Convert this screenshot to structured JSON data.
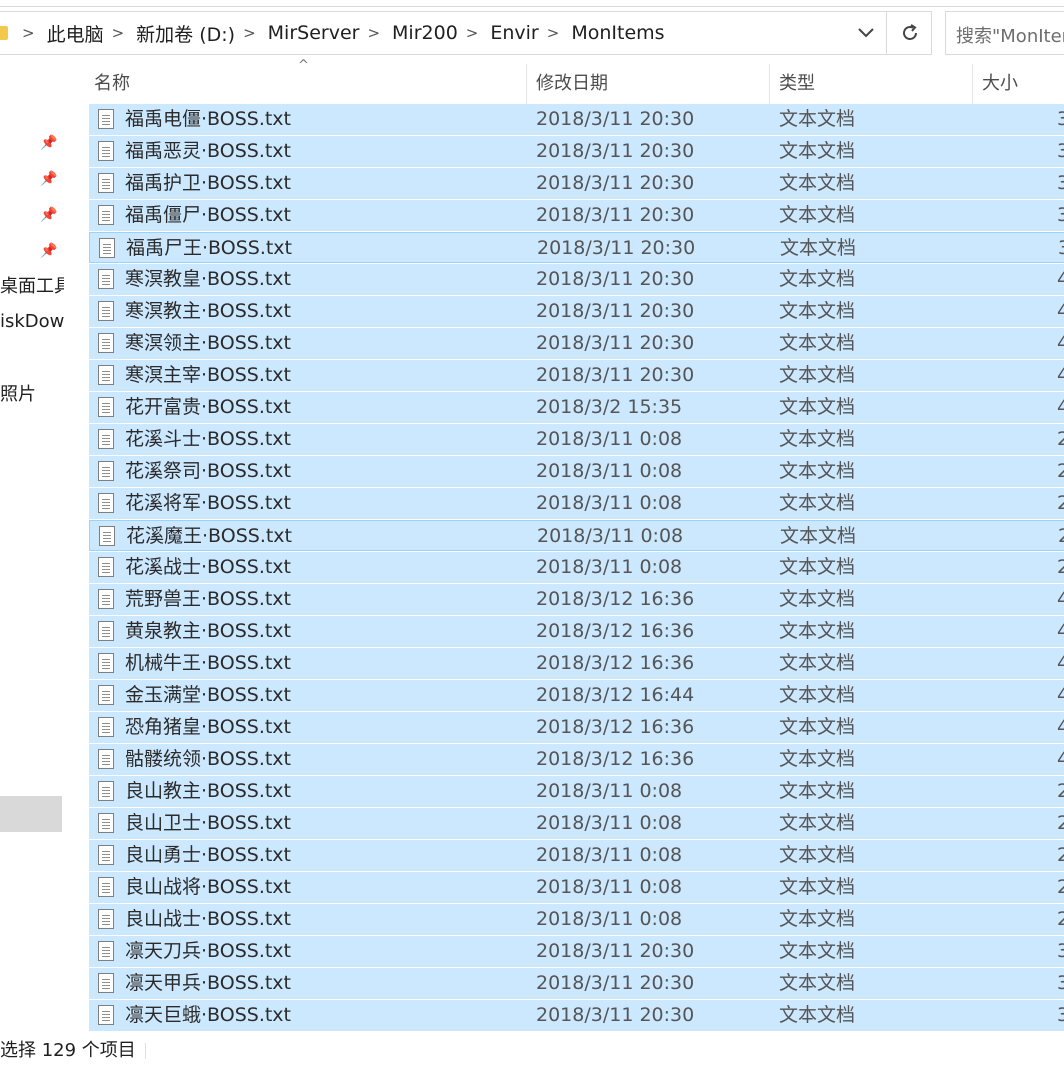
{
  "breadcrumb": [
    "此电脑",
    "新加卷 (D:)",
    "MirServer",
    "Mir200",
    "Envir",
    "MonItems"
  ],
  "search": {
    "placeholder": "搜索\"MonItems\""
  },
  "nav": {
    "items": [
      "桌面工具",
      "iskDown",
      "照片"
    ]
  },
  "columns": {
    "name": "名称",
    "date": "修改日期",
    "type": "类型",
    "size": "大小"
  },
  "files": [
    {
      "name": "福禹电僵·BOSS.txt",
      "date": "2018/3/11 20:30",
      "type": "文本文档",
      "size": "3"
    },
    {
      "name": "福禹恶灵·BOSS.txt",
      "date": "2018/3/11 20:30",
      "type": "文本文档",
      "size": "3"
    },
    {
      "name": "福禹护卫·BOSS.txt",
      "date": "2018/3/11 20:30",
      "type": "文本文档",
      "size": "3"
    },
    {
      "name": "福禹僵尸·BOSS.txt",
      "date": "2018/3/11 20:30",
      "type": "文本文档",
      "size": "3"
    },
    {
      "name": "福禹尸王·BOSS.txt",
      "date": "2018/3/11 20:30",
      "type": "文本文档",
      "size": "3"
    },
    {
      "name": "寒溟教皇·BOSS.txt",
      "date": "2018/3/11 20:30",
      "type": "文本文档",
      "size": "4"
    },
    {
      "name": "寒溟教主·BOSS.txt",
      "date": "2018/3/11 20:30",
      "type": "文本文档",
      "size": "4"
    },
    {
      "name": "寒溟领主·BOSS.txt",
      "date": "2018/3/11 20:30",
      "type": "文本文档",
      "size": "4"
    },
    {
      "name": "寒溟主宰·BOSS.txt",
      "date": "2018/3/11 20:30",
      "type": "文本文档",
      "size": "4"
    },
    {
      "name": "花开富贵·BOSS.txt",
      "date": "2018/3/2 15:35",
      "type": "文本文档",
      "size": "4"
    },
    {
      "name": "花溪斗士·BOSS.txt",
      "date": "2018/3/11 0:08",
      "type": "文本文档",
      "size": "2"
    },
    {
      "name": "花溪祭司·BOSS.txt",
      "date": "2018/3/11 0:08",
      "type": "文本文档",
      "size": "2"
    },
    {
      "name": "花溪将军·BOSS.txt",
      "date": "2018/3/11 0:08",
      "type": "文本文档",
      "size": "2"
    },
    {
      "name": "花溪魔王·BOSS.txt",
      "date": "2018/3/11 0:08",
      "type": "文本文档",
      "size": "2"
    },
    {
      "name": "花溪战士·BOSS.txt",
      "date": "2018/3/11 0:08",
      "type": "文本文档",
      "size": "2"
    },
    {
      "name": "荒野兽王·BOSS.txt",
      "date": "2018/3/12 16:36",
      "type": "文本文档",
      "size": "4"
    },
    {
      "name": "黄泉教主·BOSS.txt",
      "date": "2018/3/12 16:36",
      "type": "文本文档",
      "size": "4"
    },
    {
      "name": "机械牛王·BOSS.txt",
      "date": "2018/3/12 16:36",
      "type": "文本文档",
      "size": "4"
    },
    {
      "name": "金玉满堂·BOSS.txt",
      "date": "2018/3/12 16:44",
      "type": "文本文档",
      "size": "4"
    },
    {
      "name": "恐角猪皇·BOSS.txt",
      "date": "2018/3/12 16:36",
      "type": "文本文档",
      "size": "4"
    },
    {
      "name": "骷髅统领·BOSS.txt",
      "date": "2018/3/12 16:36",
      "type": "文本文档",
      "size": "4"
    },
    {
      "name": "良山教主·BOSS.txt",
      "date": "2018/3/11 0:08",
      "type": "文本文档",
      "size": "2"
    },
    {
      "name": "良山卫士·BOSS.txt",
      "date": "2018/3/11 0:08",
      "type": "文本文档",
      "size": "2"
    },
    {
      "name": "良山勇士·BOSS.txt",
      "date": "2018/3/11 0:08",
      "type": "文本文档",
      "size": "2"
    },
    {
      "name": "良山战将·BOSS.txt",
      "date": "2018/3/11 0:08",
      "type": "文本文档",
      "size": "2"
    },
    {
      "name": "良山战士·BOSS.txt",
      "date": "2018/3/11 0:08",
      "type": "文本文档",
      "size": "2"
    },
    {
      "name": "凛天刀兵·BOSS.txt",
      "date": "2018/3/11 20:30",
      "type": "文本文档",
      "size": "3"
    },
    {
      "name": "凛天甲兵·BOSS.txt",
      "date": "2018/3/11 20:30",
      "type": "文本文档",
      "size": "3"
    },
    {
      "name": "凛天巨蛾·BOSS.txt",
      "date": "2018/3/11 20:30",
      "type": "文本文档",
      "size": "3"
    }
  ],
  "status": {
    "selection": "选择 129 个项目"
  },
  "colors": {
    "selection": "#cce8ff",
    "focus_border": "#99d1ff"
  },
  "icons": {
    "history": "chevron-down-icon",
    "refresh": "refresh-icon",
    "file": "text-file-icon",
    "pin": "pin-icon"
  }
}
